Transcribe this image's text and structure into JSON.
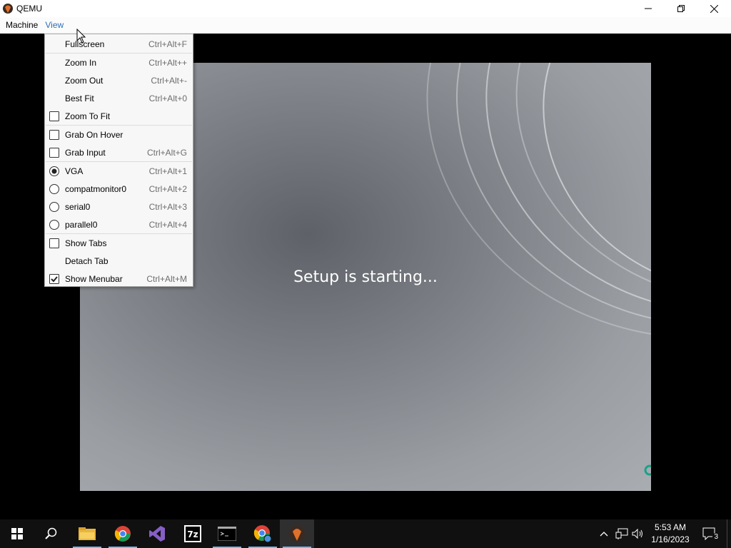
{
  "window": {
    "title": "QEMU"
  },
  "menubar": {
    "items": [
      "Machine",
      "View"
    ]
  },
  "view_menu": {
    "items": [
      {
        "label": "Fullscreen",
        "shortcut": "Ctrl+Alt+F",
        "mark": "none"
      },
      {
        "label": "Zoom In",
        "shortcut": "Ctrl+Alt++",
        "mark": "none"
      },
      {
        "label": "Zoom Out",
        "shortcut": "Ctrl+Alt+-",
        "mark": "none"
      },
      {
        "label": "Best Fit",
        "shortcut": "Ctrl+Alt+0",
        "mark": "none"
      },
      {
        "label": "Zoom To Fit",
        "shortcut": "",
        "mark": "checkbox",
        "checked": false
      },
      {
        "label": "Grab On Hover",
        "shortcut": "",
        "mark": "checkbox",
        "checked": false
      },
      {
        "label": "Grab Input",
        "shortcut": "Ctrl+Alt+G",
        "mark": "checkbox",
        "checked": false
      },
      {
        "label": "VGA",
        "shortcut": "Ctrl+Alt+1",
        "mark": "radio",
        "checked": true
      },
      {
        "label": "compatmonitor0",
        "shortcut": "Ctrl+Alt+2",
        "mark": "radio",
        "checked": false
      },
      {
        "label": "serial0",
        "shortcut": "Ctrl+Alt+3",
        "mark": "radio",
        "checked": false
      },
      {
        "label": "parallel0",
        "shortcut": "Ctrl+Alt+4",
        "mark": "radio",
        "checked": false
      },
      {
        "label": "Show Tabs",
        "shortcut": "",
        "mark": "checkbox",
        "checked": false
      },
      {
        "label": "Detach Tab",
        "shortcut": "",
        "mark": "none"
      },
      {
        "label": "Show Menubar",
        "shortcut": "Ctrl+Alt+M",
        "mark": "checkbox",
        "checked": true
      }
    ]
  },
  "guest": {
    "status_text": "Setup is starting..."
  },
  "taskbar": {
    "apps": [
      "start-icon",
      "search-icon",
      "file-explorer-icon",
      "chrome-icon",
      "visual-studio-icon",
      "7zip-icon",
      "terminal-icon",
      "chrome-alt-icon",
      "qemu-icon"
    ],
    "time": "5:53 AM",
    "date": "1/16/2023",
    "notification_count": "3"
  },
  "colors": {
    "accent": "#2a6fb8",
    "taskbar": "#101010",
    "highlight": "#76b9ed"
  }
}
